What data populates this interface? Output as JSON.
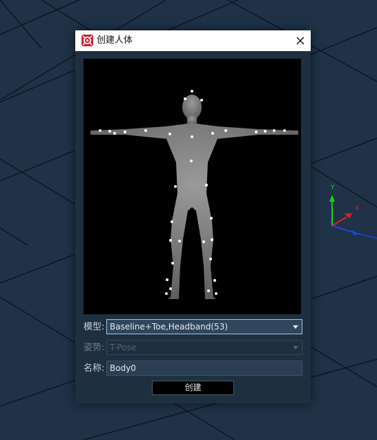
{
  "dialog": {
    "title": "创建人体",
    "model_label": "模型:",
    "model_value": "Baseline+Toe,Headband(53)",
    "pose_label": "姿势:",
    "pose_value": "T-Pose",
    "name_label": "名称:",
    "name_value": "Body0",
    "create_label": "创建"
  },
  "gizmo": {
    "y_label": "Y",
    "x_label": "X"
  },
  "colors": {
    "background": "#1f3247",
    "dialog_bg": "#1e2f40",
    "accent_red": "#cf2030",
    "axis_y": "#22cc22",
    "axis_x": "#dd2222",
    "axis_z": "#2244dd"
  },
  "icons": {
    "logo": "app-logo-icon",
    "close": "close-icon",
    "dropdown": "chevron-down-icon"
  }
}
